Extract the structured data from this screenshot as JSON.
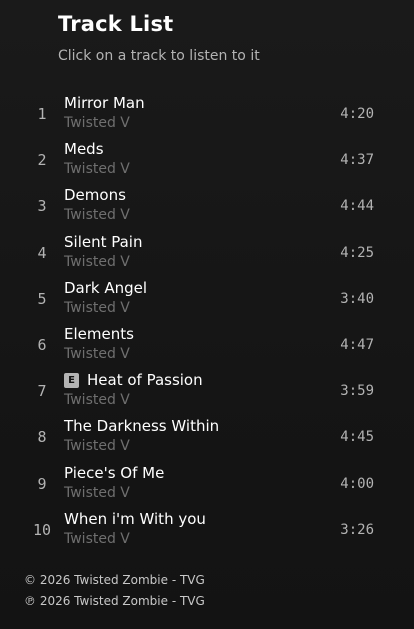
{
  "header": {
    "title": "Track List",
    "subtitle": "Click on a track to listen to it"
  },
  "tracks": [
    {
      "number": "1",
      "title": "Mirror Man",
      "artist": "Twisted V",
      "duration": "4:20",
      "explicit": false
    },
    {
      "number": "2",
      "title": "Meds",
      "artist": "Twisted V",
      "duration": "4:37",
      "explicit": false
    },
    {
      "number": "3",
      "title": "Demons",
      "artist": "Twisted V",
      "duration": "4:44",
      "explicit": false
    },
    {
      "number": "4",
      "title": "Silent Pain",
      "artist": "Twisted V",
      "duration": "4:25",
      "explicit": false
    },
    {
      "number": "5",
      "title": "Dark Angel",
      "artist": "Twisted V",
      "duration": "3:40",
      "explicit": false
    },
    {
      "number": "6",
      "title": "Elements",
      "artist": "Twisted V",
      "duration": "4:47",
      "explicit": false
    },
    {
      "number": "7",
      "title": "Heat of Passion",
      "artist": "Twisted V",
      "duration": "3:59",
      "explicit": true,
      "explicit_label": "E"
    },
    {
      "number": "8",
      "title": "The Darkness Within",
      "artist": "Twisted V",
      "duration": "4:45",
      "explicit": false
    },
    {
      "number": "9",
      "title": "Piece's Of Me",
      "artist": "Twisted V",
      "duration": "4:00",
      "explicit": false
    },
    {
      "number": "10",
      "title": "When i'm With you",
      "artist": "Twisted V",
      "duration": "3:26",
      "explicit": false
    }
  ],
  "footer": {
    "copyright": "© 2026 Twisted Zombie - TVG",
    "phonogram": "℗ 2026 Twisted Zombie - TVG"
  },
  "colors": {
    "background": "#121212",
    "primary_text": "#ffffff",
    "secondary_text": "#b3b3b3",
    "artist_text": "#6f6f6f"
  }
}
